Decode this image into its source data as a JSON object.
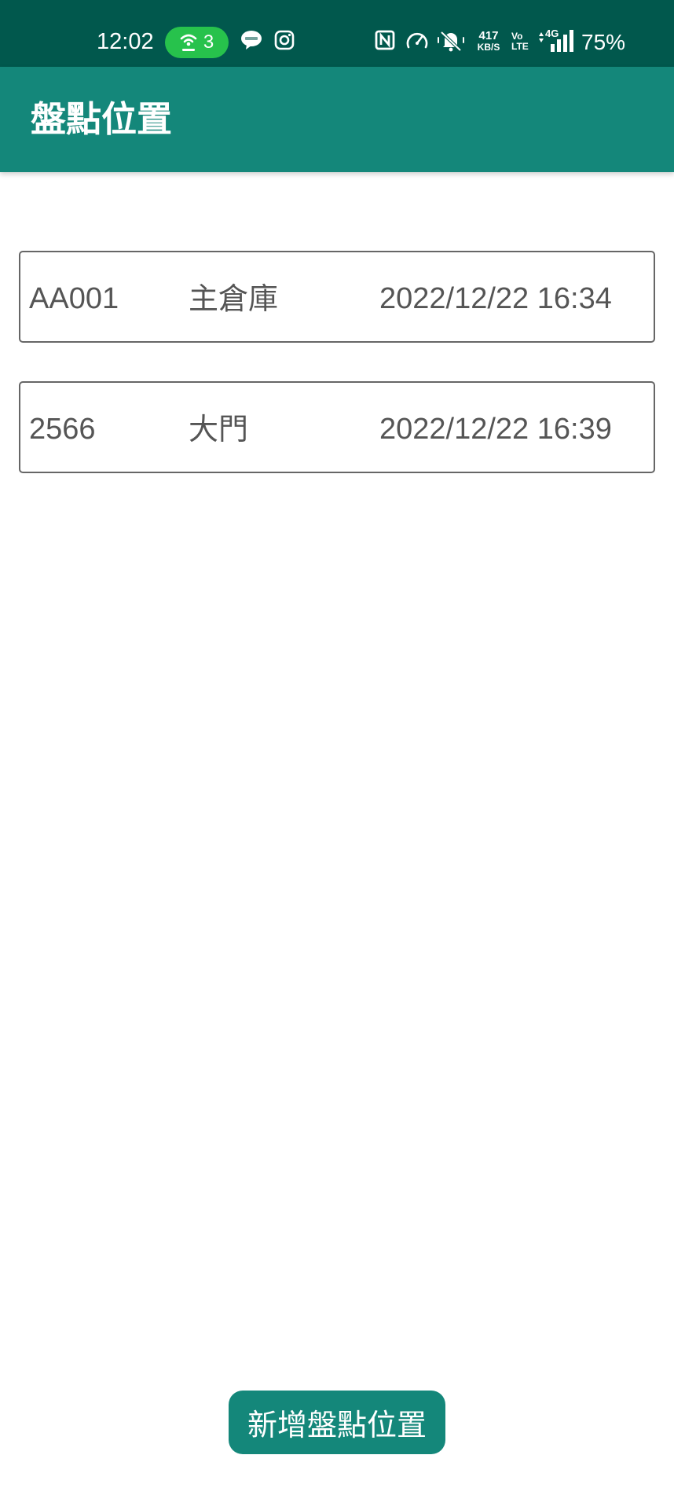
{
  "status_bar": {
    "time": "12:02",
    "hotspot_count": "3",
    "data_speed_value": "417",
    "data_speed_unit": "KB/S",
    "volte_line1": "Vo",
    "volte_line2": "LTE",
    "network_type": "4G",
    "battery": "75%",
    "icons": [
      "hotspot-icon",
      "line-app-icon",
      "instagram-icon",
      "nfc-icon",
      "speedometer-icon",
      "bell-muted-icon",
      "signal-icon"
    ],
    "background_color": "#01584d"
  },
  "app_bar": {
    "title": "盤點位置",
    "background_color": "#14877a"
  },
  "locations": [
    {
      "code": "AA001",
      "name": "主倉庫",
      "timestamp": "2022/12/22 16:34"
    },
    {
      "code": "2566",
      "name": "大門",
      "timestamp": "2022/12/22 16:39"
    }
  ],
  "add_button": {
    "label": "新增盤點位置",
    "color": "#14877a"
  }
}
